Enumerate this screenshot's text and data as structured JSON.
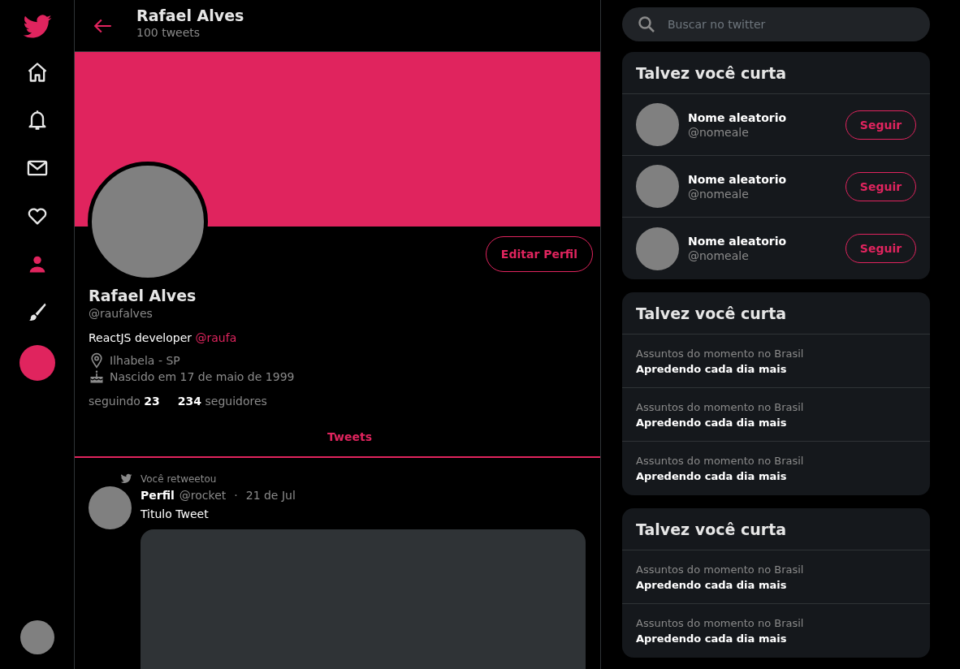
{
  "sidebar": {
    "items": [
      {
        "kind": "home",
        "selected": false
      },
      {
        "kind": "bell",
        "selected": false
      },
      {
        "kind": "mail",
        "selected": false
      },
      {
        "kind": "heart",
        "selected": false
      },
      {
        "kind": "person",
        "selected": true
      },
      {
        "kind": "brush",
        "selected": false
      }
    ]
  },
  "header": {
    "title": "Rafael Alves",
    "subtitle": "100 tweets"
  },
  "profile": {
    "name": "Rafael Alves",
    "handle": "@raufalves",
    "bio": "ReactJS developer",
    "bio_link": "@raufa",
    "location": "Ilhabela - SP",
    "birthday": "Nascido em 17 de maio de 1999",
    "following": "seguindo **23**",
    "followers": "**234** seguidores",
    "edit_button": "Editar Perfil"
  },
  "tabs": [
    {
      "label": "Tweets",
      "selected": true
    }
  ],
  "tweet": {
    "retweet_note": "Você retweetou",
    "author": "Perfil",
    "handle": "@rocket",
    "separator": "·",
    "date": "21 de Jul",
    "text": "Titulo Tweet"
  },
  "search": {
    "placeholder": "Buscar no twitter"
  },
  "panels": [
    {
      "title": "Talvez você curta",
      "kind": "follow",
      "items": [
        {
          "name": "Nome aleatorio",
          "handle": "@nomeale",
          "button": "Seguir"
        },
        {
          "name": "Nome aleatorio",
          "handle": "@nomeale",
          "button": "Seguir"
        },
        {
          "name": "Nome aleatorio",
          "handle": "@nomeale",
          "button": "Seguir"
        }
      ]
    },
    {
      "title": "Talvez você curta",
      "kind": "trends",
      "items": [
        {
          "category": "Assuntos do momento no Brasil",
          "topic": "Apredendo cada dia mais"
        },
        {
          "category": "Assuntos do momento no Brasil",
          "topic": "Apredendo cada dia mais"
        },
        {
          "category": "Assuntos do momento no Brasil",
          "topic": "Apredendo cada dia mais"
        }
      ]
    },
    {
      "title": "Talvez você curta",
      "kind": "trends",
      "items": [
        {
          "category": "Assuntos do momento no Brasil",
          "topic": "Apredendo cada dia mais"
        },
        {
          "category": "Assuntos do momento no Brasil",
          "topic": "Apredendo cada dia mais"
        }
      ]
    }
  ]
}
